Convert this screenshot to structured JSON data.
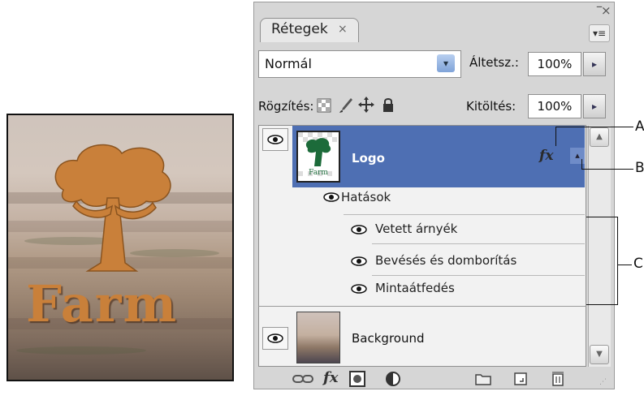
{
  "artwork": {
    "text": "Farm"
  },
  "panel": {
    "tab_label": "Rétegek",
    "tab_close": "×",
    "minimize": "–",
    "close": "×",
    "menu_icon": "▾≡"
  },
  "blend": {
    "value": "Normál",
    "arrow": "▾"
  },
  "opacity": {
    "label": "Áltetsz.:",
    "value": "100%",
    "arrow": "▸"
  },
  "lock": {
    "label": "Rögzítés:"
  },
  "fill": {
    "label": "Kitöltés:",
    "value": "100%",
    "arrow": "▸"
  },
  "layers": {
    "logo": {
      "name": "Logo",
      "fx": "fx",
      "expand": "▴",
      "eye": "👁"
    },
    "effects": {
      "header": "Hatások",
      "items": [
        "Vetett árnyék",
        "Bevésés és domborítás",
        "Mintaátfedés"
      ]
    },
    "background": {
      "name": "Background",
      "eye": "👁"
    }
  },
  "bottom_bar": {
    "icons": [
      "link-icon",
      "fx-icon",
      "mask-icon",
      "adjustment-icon",
      "folder-icon",
      "new-layer-icon",
      "trash-icon"
    ],
    "fx_label": "fx"
  },
  "callouts": {
    "a": "A",
    "b": "B",
    "c": "C"
  },
  "colors": {
    "selected_row": "#4e6fb3",
    "panel_bg": "#d6d6d6",
    "farm_text": "#c9803a"
  }
}
